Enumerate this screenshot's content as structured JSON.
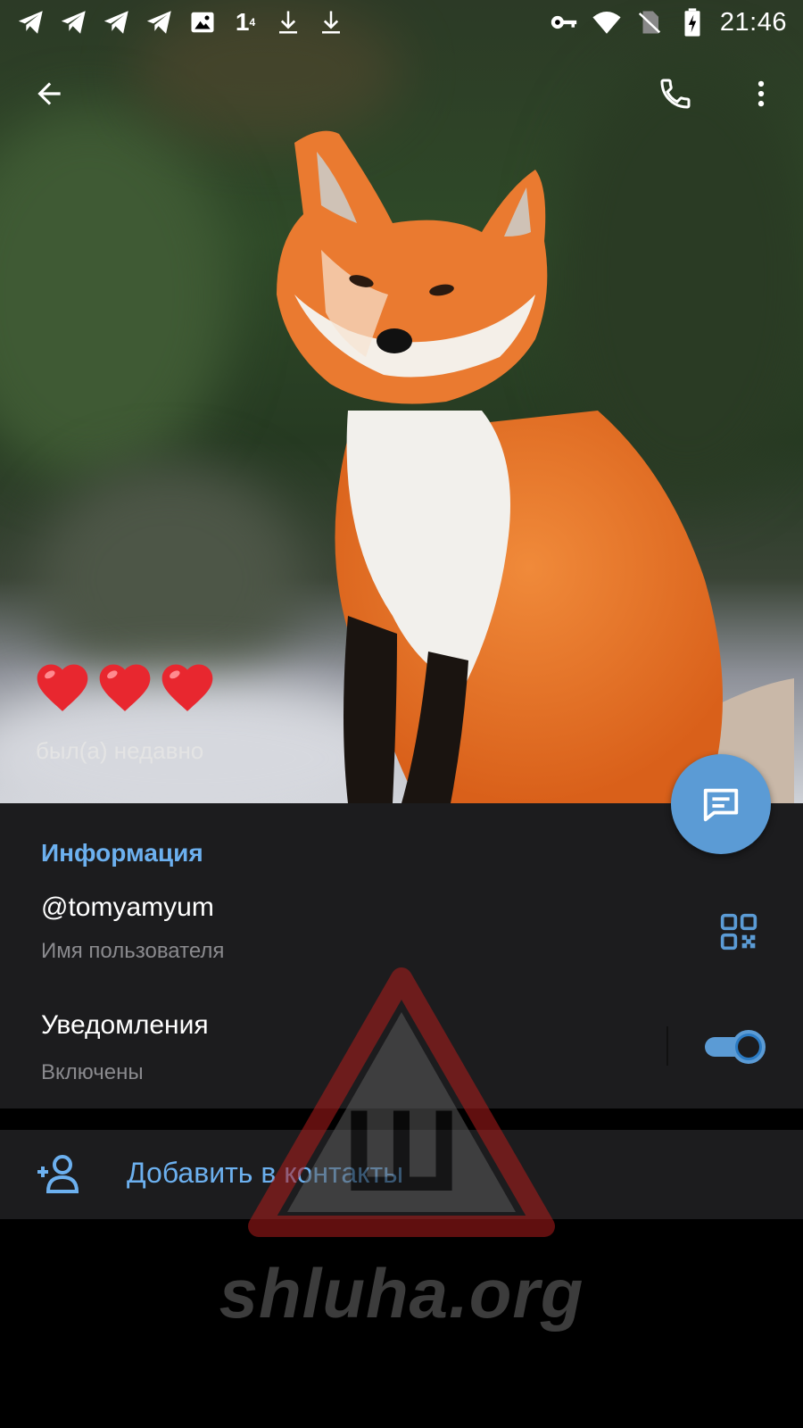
{
  "status_bar": {
    "time": "21:46",
    "left_icons": [
      "telegram-icon",
      "telegram-icon",
      "telegram-icon",
      "telegram-icon",
      "image-icon",
      "notification-count-icon",
      "download-icon",
      "download-icon"
    ],
    "notification_badge": "1",
    "notification_badge_sup": "4",
    "right_icons": [
      "vpn-key-icon",
      "wifi-icon",
      "no-sim-icon",
      "battery-charging-icon"
    ]
  },
  "top_bar": {
    "back_icon": "arrow-back-icon",
    "call_icon": "phone-icon",
    "more_icon": "more-vertical-icon"
  },
  "profile": {
    "name": "❤️❤️❤️",
    "last_seen": "был(а) недавно"
  },
  "info": {
    "section_title": "Информация",
    "username": "@tomyamyum",
    "username_caption": "Имя пользователя",
    "notifications_label": "Уведомления",
    "notifications_status": "Включены",
    "notifications_enabled": true
  },
  "actions": {
    "add_contact_label": "Добавить в контакты"
  },
  "watermark": {
    "text": "shluha.org",
    "glyph": "Ш"
  },
  "colors": {
    "accent": "#5b9bd5",
    "link": "#6cb0ef",
    "surface": "#1c1c1e",
    "background": "#000000"
  }
}
